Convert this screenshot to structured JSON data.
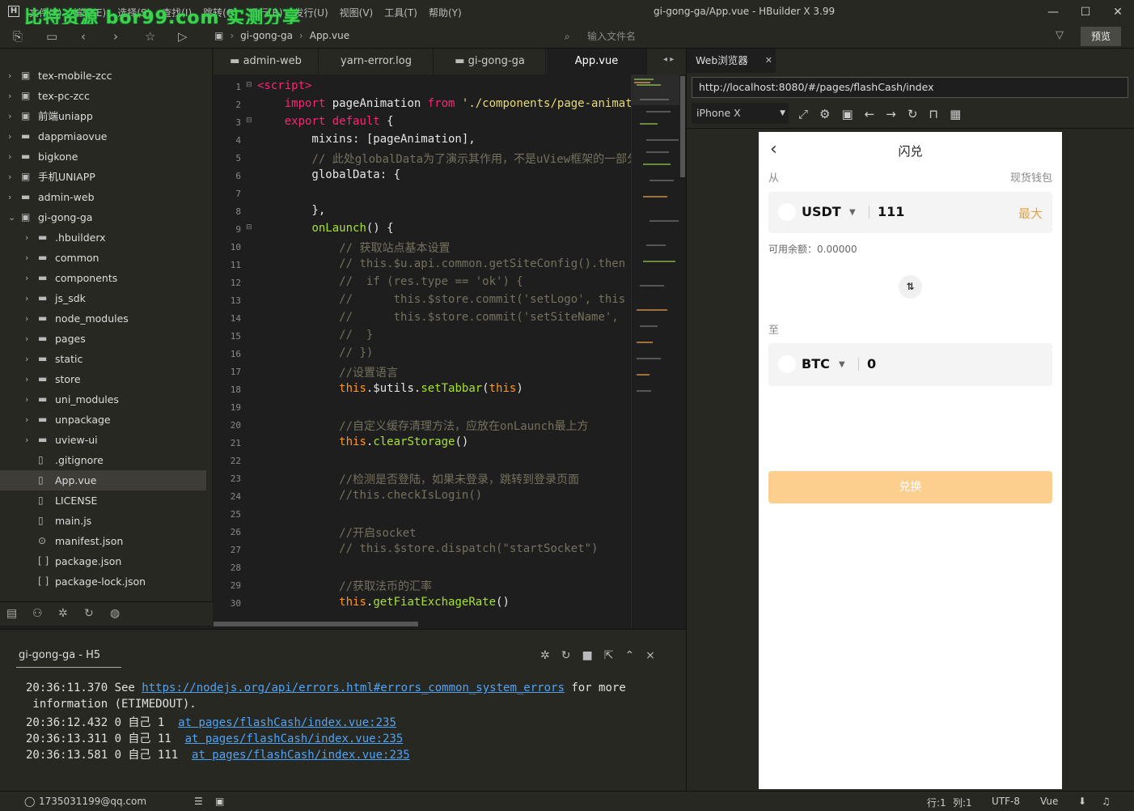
{
  "titlebar": {
    "watermark": "比特资源 bor99.com 实测分享",
    "menu": [
      "文件(F)",
      "编辑(E)",
      "选择(S)",
      "查找(I)",
      "跳转(G)",
      "运行(R)",
      "发行(U)",
      "视图(V)",
      "工具(T)",
      "帮助(Y)"
    ],
    "title": "gi-gong-ga/App.vue - HBuilder X 3.99",
    "logo": "H"
  },
  "toolbar": {
    "crumb_project": "gi-gong-ga",
    "crumb_file": "App.vue",
    "search_placeholder": "输入文件名",
    "preview_label": "预览"
  },
  "sidebar": {
    "items": [
      {
        "label": "tex-mobile-zcc",
        "type": "project"
      },
      {
        "label": "tex-pc-zcc",
        "type": "project"
      },
      {
        "label": "前端uniapp",
        "type": "project"
      },
      {
        "label": "dappmiaovue",
        "type": "folder"
      },
      {
        "label": "bigkone",
        "type": "folder"
      },
      {
        "label": "手机UNIAPP",
        "type": "project"
      },
      {
        "label": "admin-web",
        "type": "folder"
      },
      {
        "label": "gi-gong-ga",
        "type": "project-open"
      },
      {
        "label": ".hbuilderx",
        "type": "subfolder"
      },
      {
        "label": "common",
        "type": "subfolder"
      },
      {
        "label": "components",
        "type": "subfolder"
      },
      {
        "label": "js_sdk",
        "type": "subfolder"
      },
      {
        "label": "node_modules",
        "type": "subfolder"
      },
      {
        "label": "pages",
        "type": "subfolder"
      },
      {
        "label": "static",
        "type": "subfolder"
      },
      {
        "label": "store",
        "type": "subfolder"
      },
      {
        "label": "uni_modules",
        "type": "subfolder"
      },
      {
        "label": "unpackage",
        "type": "subfolder"
      },
      {
        "label": "uview-ui",
        "type": "subfolder"
      },
      {
        "label": ".gitignore",
        "type": "file"
      },
      {
        "label": "App.vue",
        "type": "file-vue",
        "selected": true
      },
      {
        "label": "LICENSE",
        "type": "file"
      },
      {
        "label": "main.js",
        "type": "file"
      },
      {
        "label": "manifest.json",
        "type": "file-manifest"
      },
      {
        "label": "package.json",
        "type": "file-json"
      },
      {
        "label": "package-lock.json",
        "type": "file-json"
      }
    ]
  },
  "tabs": [
    {
      "label": "admin-web",
      "active": false
    },
    {
      "label": "yarn-error.log",
      "active": false
    },
    {
      "label": "gi-gong-ga",
      "active": false
    },
    {
      "label": "App.vue",
      "active": true
    }
  ],
  "editor": {
    "lines": [
      "1",
      "2",
      "3",
      "4",
      "5",
      "6",
      "7",
      "8",
      "9",
      "10",
      "11",
      "12",
      "13",
      "14",
      "15",
      "16",
      "17",
      "18",
      "19",
      "20",
      "21",
      "22",
      "23",
      "24",
      "25",
      "26",
      "27",
      "28",
      "29",
      "30"
    ]
  },
  "console": {
    "tab_label": "gi-gong-ga - H5",
    "line1_prefix": "20:36:11.370 See ",
    "line1_link": "https://nodejs.org/api/errors.html#errors_common_system_errors",
    "line1_suffix": " for more",
    "line2": " information (ETIMEDOUT).",
    "line3_text": "20:36:12.432 0 自己 1  ",
    "line3_link": "at pages/flashCash/index.vue:235",
    "line4_text": "20:36:13.311 0 自己 11  ",
    "line4_link": "at pages/flashCash/index.vue:235",
    "line5_text": "20:36:13.581 0 自己 111  ",
    "line5_link": "at pages/flashCash/index.vue:235"
  },
  "statusbar": {
    "user": "1735031199@qq.com",
    "position_line": "行:1",
    "position_col": "列:1",
    "encoding": "UTF-8",
    "language": "Vue"
  },
  "browser": {
    "tab_label": "Web浏览器",
    "url": "http://localhost:8080/#/pages/flashCash/index",
    "device": "iPhone X"
  },
  "phone": {
    "title": "闪兑",
    "from_label": "从",
    "wallet_label": "现货钱包",
    "from_coin": "USDT",
    "from_amount": "111",
    "max_label": "最大",
    "balance_label": "可用余额：0.00000",
    "to_label": "至",
    "to_coin": "BTC",
    "to_amount": "0",
    "swap_icon": "⇅",
    "button_label": "兑换"
  },
  "colors": {
    "accent_orange": "#fccf8f",
    "max_orange": "#e0a54a",
    "link_blue": "#4fa3f7"
  }
}
